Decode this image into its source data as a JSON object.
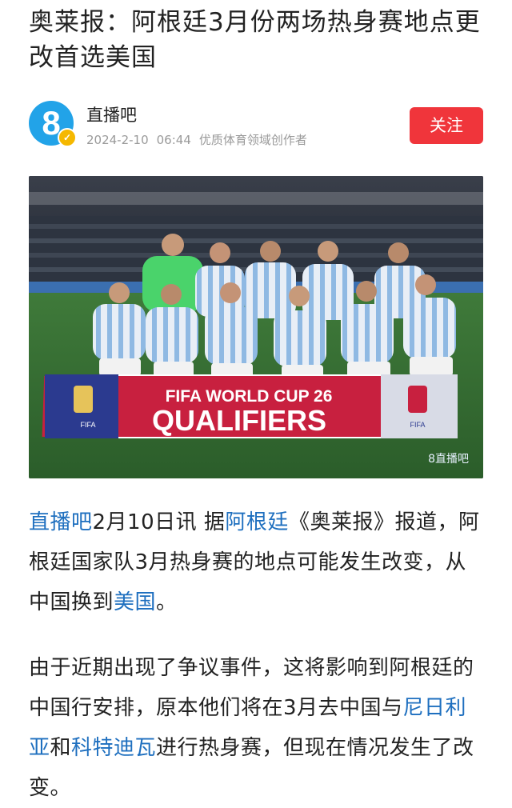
{
  "article": {
    "title": "奥莱报：阿根廷3月份两场热身赛地点更改首选美国"
  },
  "author": {
    "avatar_text": "8",
    "name": "直播吧",
    "date": "2024-2-10",
    "time": "06:44",
    "tag": "优质体育领域创作者",
    "follow_label": "关注"
  },
  "photo": {
    "banner_line1": "FIFA WORLD CUP 26",
    "banner_line2": "QUALIFIERS",
    "fifa_small": "FIFA",
    "watermark": "8直播吧"
  },
  "paragraph1": {
    "s1": "直播吧",
    "s2": "2月10日讯 据",
    "s3": "阿根廷",
    "s4": "《奥莱报》报道，阿根廷国家队3月热身赛的地点可能发生改变，从中国换到",
    "s5": "美国",
    "s6": "。"
  },
  "paragraph2": {
    "s1": "由于近期出现了争议事件，这将影响到阿根廷的中国行安排，原本他们将在3月去中国与",
    "s2": "尼日利亚",
    "s3": "和",
    "s4": "科特迪瓦",
    "s5": "进行热身赛，但现在情况发生了改变。"
  },
  "colors": {
    "link": "#1e6fbf",
    "follow_button": "#f0353b",
    "avatar": "#22a3e8"
  }
}
